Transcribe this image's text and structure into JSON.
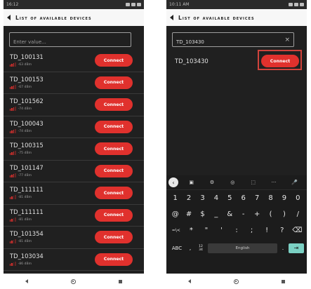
{
  "phone1": {
    "status_time": "16:12",
    "title": "List of available devices",
    "search_placeholder": "Enter value...",
    "connect_label": "Connect",
    "devices": [
      {
        "name": "TD_100131",
        "signal": "-63 dBm",
        "strength": 2
      },
      {
        "name": "TD_100153",
        "signal": "-67 dBm",
        "strength": 2
      },
      {
        "name": "TD_101562",
        "signal": "-74 dBm",
        "strength": 2
      },
      {
        "name": "TD_100043",
        "signal": "-74 dBm",
        "strength": 2
      },
      {
        "name": "TD_100315",
        "signal": "-75 dBm",
        "strength": 2
      },
      {
        "name": "TD_101147",
        "signal": "-77 dBm",
        "strength": 2
      },
      {
        "name": "TD_111111",
        "signal": "-81 dBm",
        "strength": 1
      },
      {
        "name": "TD_111111",
        "signal": "-81 dBm",
        "strength": 1
      },
      {
        "name": "TD_101354",
        "signal": "-81 dBm",
        "strength": 1
      },
      {
        "name": "TD_103034",
        "signal": "-86 dBm",
        "strength": 1
      }
    ]
  },
  "phone2": {
    "status_time": "10:11 AM",
    "title": "List of available devices",
    "search_value": "TD_103430",
    "clear_symbol": "×",
    "result_name": "TD_103430",
    "connect_label": "Connect",
    "keyboard": {
      "toolbar": [
        "‹",
        "▣",
        "⚙",
        "◎",
        "⬚",
        "···",
        "🎤"
      ],
      "row_numbers": [
        "1",
        "2",
        "3",
        "4",
        "5",
        "6",
        "7",
        "8",
        "9",
        "0"
      ],
      "row_symbols1": [
        "@",
        "#",
        "$",
        "_",
        "&",
        "-",
        "+",
        "(",
        ")",
        "/"
      ],
      "row_symbols2": [
        "=\\<",
        "*",
        "\"",
        "'",
        ":",
        ";",
        "!",
        "?",
        "⌫"
      ],
      "abc": "ABC",
      "comma": ",",
      "num_top": "12",
      "num_bottom": "34",
      "space": "English",
      "dot": ".",
      "enter": "⇥"
    }
  },
  "colors": {
    "accent": "#e0312d",
    "dark_bg": "#202020",
    "highlight_border": "#d0433c",
    "enter_key": "#7bd0c3"
  }
}
